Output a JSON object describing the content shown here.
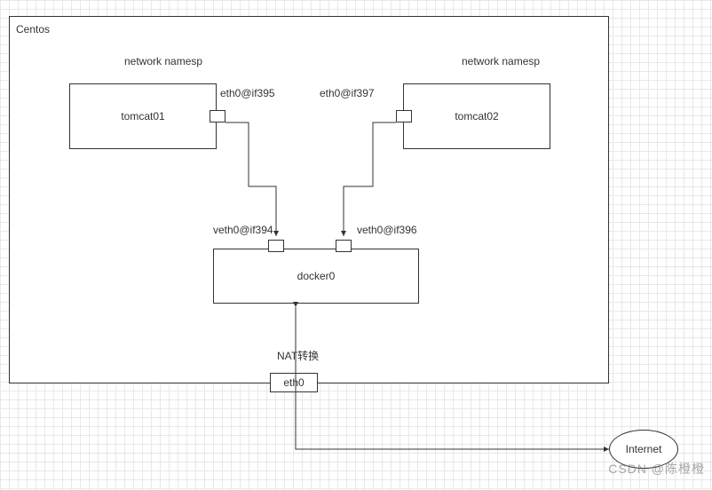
{
  "host_label": "Centos",
  "namespace_label1": "network namesp",
  "namespace_label2": "network namesp",
  "container1": "tomcat01",
  "container2": "tomcat02",
  "eth1": "eth0@if395",
  "eth2": "eth0@if397",
  "veth1": "veth0@if394",
  "veth2": "veth0@if396",
  "bridge": "docker0",
  "nat": "NAT转换",
  "host_iface": "eth0",
  "internet": "Internet",
  "watermark": "CSDN @陈橙橙"
}
